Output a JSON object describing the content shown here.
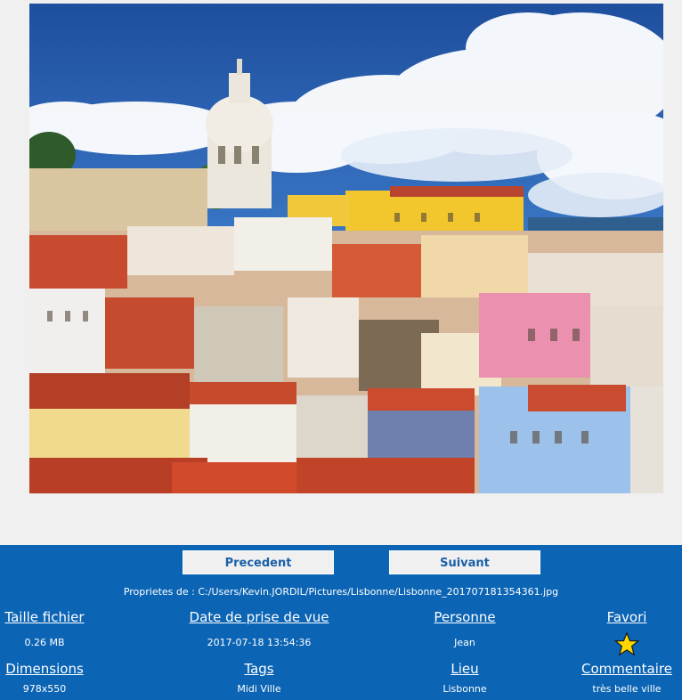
{
  "nav": {
    "prev_label": "Precedent",
    "next_label": "Suivant"
  },
  "properties_path": "Proprietes de : C:/Users/Kevin.JORDIL/Pictures/Lisbonne/Lisbonne_201707181354361.jpg",
  "fields": {
    "size_label": "Taille fichier",
    "size_value": "0.26 MB",
    "date_label": "Date de prise de vue",
    "date_value": "2017-07-18 13:54:36",
    "person_label": "Personne",
    "person_value": "Jean",
    "favorite_label": "Favori",
    "favorite_icon": "star-icon",
    "dimensions_label": "Dimensions",
    "dimensions_value": "978x550",
    "tags_label": "Tags",
    "tags_value": "Midi Ville",
    "place_label": "Lieu",
    "place_value": "Lisbonne",
    "comment_label": "Commentaire",
    "comment_value": "très belle ville"
  },
  "colors": {
    "panel_bg": "#0b64b4",
    "button_text": "#1a5fa8",
    "star": "#ffd700"
  }
}
